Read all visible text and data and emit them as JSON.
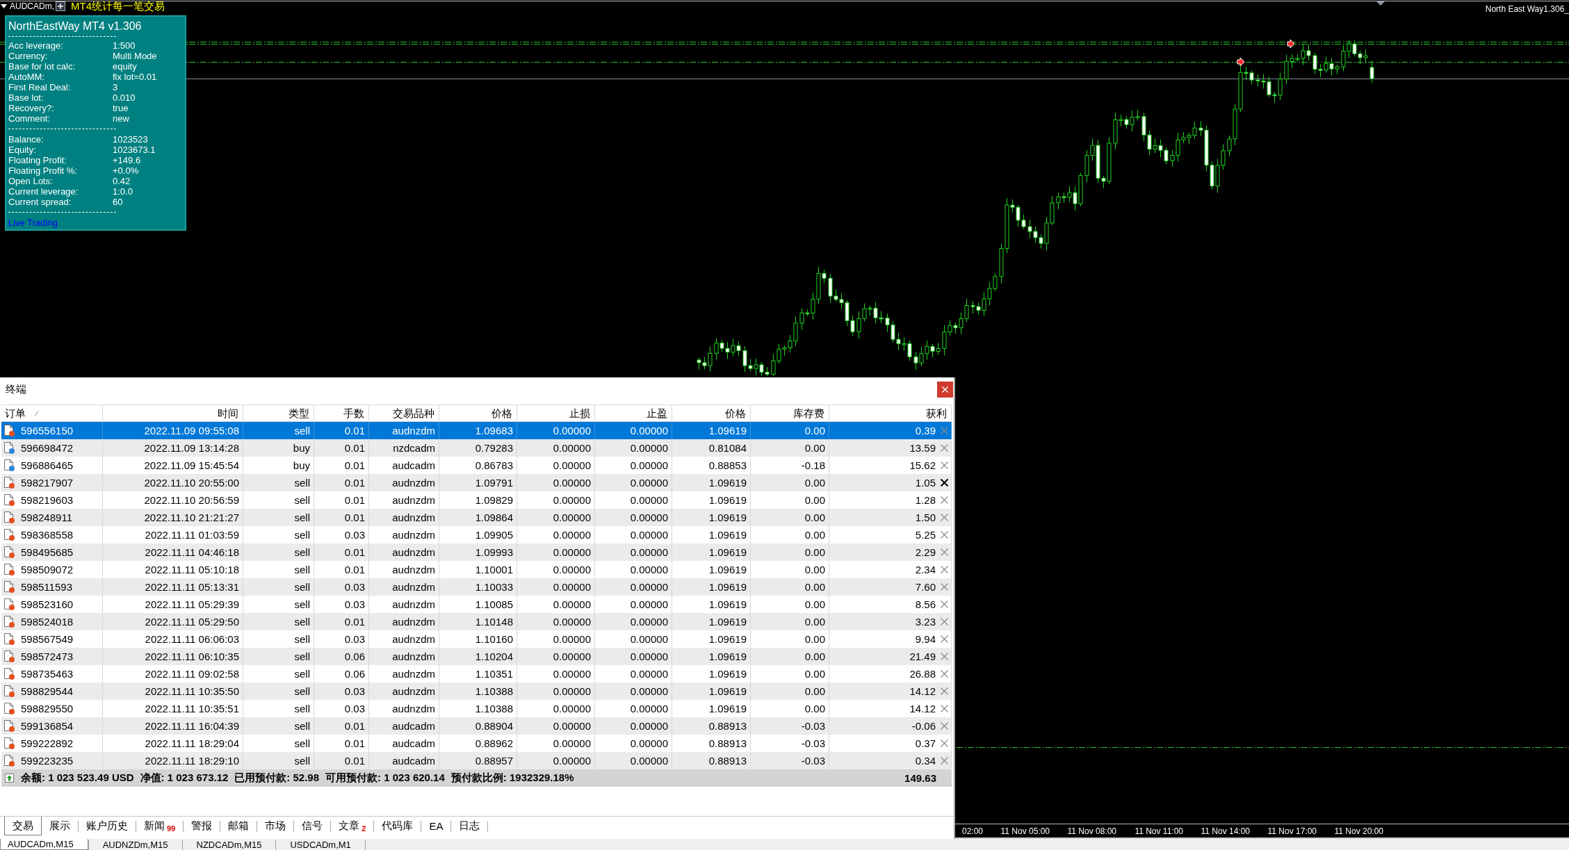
{
  "chart": {
    "symbol_label": "AUDCADm,",
    "indicator_title": "MT4统计每一笔交易",
    "ea_label": "North East Way1.306_",
    "info_panel": {
      "title": "NorthEastWay MT4 v1.306",
      "settings": [
        {
          "label": "Acc leverage:",
          "value": "1:500"
        },
        {
          "label": "Currency:",
          "value": "Multi Mode"
        },
        {
          "label": "Base for lot calc:",
          "value": "equity"
        },
        {
          "label": "AutoMM:",
          "value": "fix lot=0.01"
        },
        {
          "label": "First Real Deal:",
          "value": "3"
        },
        {
          "label": "Base lot:",
          "value": "0.010"
        },
        {
          "label": "Recovery?:",
          "value": "true"
        },
        {
          "label": "Comment:",
          "value": "new"
        }
      ],
      "stats": [
        {
          "label": "Balance:",
          "value": "1023523"
        },
        {
          "label": "Equity:",
          "value": "1023673.1"
        },
        {
          "label": "Floating Profit:",
          "value": "+149.6"
        },
        {
          "label": "Floating Profit %:",
          "value": "+0.0%"
        },
        {
          "label": "Open Lots:",
          "value": "0.42"
        },
        {
          "label": "Current leverage:",
          "value": "1:0.0"
        },
        {
          "label": "Current spread:",
          "value": "60"
        }
      ],
      "mode": "Live Trading"
    },
    "time_axis": [
      "02:00",
      "11 Nov 05:00",
      "11 Nov 08:00",
      "11 Nov 11:00",
      "11 Nov 14:00",
      "11 Nov 17:00",
      "11 Nov 20:00"
    ]
  },
  "terminal": {
    "title": "终端",
    "columns": [
      {
        "label": "订单",
        "sorted": true
      },
      {
        "label": "时间",
        "sorted": false
      },
      {
        "label": "类型",
        "sorted": false
      },
      {
        "label": "手数",
        "sorted": false
      },
      {
        "label": "交易品种",
        "sorted": false
      },
      {
        "label": "价格",
        "sorted": false
      },
      {
        "label": "止损",
        "sorted": false
      },
      {
        "label": "止盈",
        "sorted": false
      },
      {
        "label": "价格",
        "sorted": false
      },
      {
        "label": "库存费",
        "sorted": false
      },
      {
        "label": "获利",
        "sorted": false
      }
    ],
    "rows": [
      {
        "cells": [
          "596556150",
          "2022.11.09 09:55:08",
          "sell",
          "0.01",
          "audnzdm",
          "1.09683",
          "0.00000",
          "0.00000",
          "1.09619",
          "0.00",
          "0.39"
        ],
        "selected": true,
        "color": "#e5501f",
        "close_hover": false
      },
      {
        "cells": [
          "596698472",
          "2022.11.09 13:14:28",
          "buy",
          "0.01",
          "nzdcadm",
          "0.79283",
          "0.00000",
          "0.00000",
          "0.81084",
          "0.00",
          "13.59"
        ],
        "selected": false,
        "color": "#2f86d8",
        "close_hover": false
      },
      {
        "cells": [
          "596886465",
          "2022.11.09 15:45:54",
          "buy",
          "0.01",
          "audcadm",
          "0.86783",
          "0.00000",
          "0.00000",
          "0.88853",
          "-0.18",
          "15.62"
        ],
        "selected": false,
        "color": "#2f86d8",
        "close_hover": false
      },
      {
        "cells": [
          "598217907",
          "2022.11.10 20:55:00",
          "sell",
          "0.01",
          "audnzdm",
          "1.09791",
          "0.00000",
          "0.00000",
          "1.09619",
          "0.00",
          "1.05"
        ],
        "selected": false,
        "color": "#e5501f",
        "close_hover": true
      },
      {
        "cells": [
          "598219603",
          "2022.11.10 20:56:59",
          "sell",
          "0.01",
          "audnzdm",
          "1.09829",
          "0.00000",
          "0.00000",
          "1.09619",
          "0.00",
          "1.28"
        ],
        "selected": false,
        "color": "#e5501f",
        "close_hover": false
      },
      {
        "cells": [
          "598248911",
          "2022.11.10 21:21:27",
          "sell",
          "0.01",
          "audnzdm",
          "1.09864",
          "0.00000",
          "0.00000",
          "1.09619",
          "0.00",
          "1.50"
        ],
        "selected": false,
        "color": "#e5501f",
        "close_hover": false
      },
      {
        "cells": [
          "598368558",
          "2022.11.11 01:03:59",
          "sell",
          "0.03",
          "audnzdm",
          "1.09905",
          "0.00000",
          "0.00000",
          "1.09619",
          "0.00",
          "5.25"
        ],
        "selected": false,
        "color": "#e5501f",
        "close_hover": false
      },
      {
        "cells": [
          "598495685",
          "2022.11.11 04:46:18",
          "sell",
          "0.01",
          "audnzdm",
          "1.09993",
          "0.00000",
          "0.00000",
          "1.09619",
          "0.00",
          "2.29"
        ],
        "selected": false,
        "color": "#e5501f",
        "close_hover": false
      },
      {
        "cells": [
          "598509072",
          "2022.11.11 05:10:18",
          "sell",
          "0.01",
          "audnzdm",
          "1.10001",
          "0.00000",
          "0.00000",
          "1.09619",
          "0.00",
          "2.34"
        ],
        "selected": false,
        "color": "#e5501f",
        "close_hover": false
      },
      {
        "cells": [
          "598511593",
          "2022.11.11 05:13:31",
          "sell",
          "0.03",
          "audnzdm",
          "1.10033",
          "0.00000",
          "0.00000",
          "1.09619",
          "0.00",
          "7.60"
        ],
        "selected": false,
        "color": "#e5501f",
        "close_hover": false
      },
      {
        "cells": [
          "598523160",
          "2022.11.11 05:29:39",
          "sell",
          "0.03",
          "audnzdm",
          "1.10085",
          "0.00000",
          "0.00000",
          "1.09619",
          "0.00",
          "8.56"
        ],
        "selected": false,
        "color": "#e5501f",
        "close_hover": false
      },
      {
        "cells": [
          "598524018",
          "2022.11.11 05:29:50",
          "sell",
          "0.01",
          "audnzdm",
          "1.10148",
          "0.00000",
          "0.00000",
          "1.09619",
          "0.00",
          "3.23"
        ],
        "selected": false,
        "color": "#e5501f",
        "close_hover": false
      },
      {
        "cells": [
          "598567549",
          "2022.11.11 06:06:03",
          "sell",
          "0.03",
          "audnzdm",
          "1.10160",
          "0.00000",
          "0.00000",
          "1.09619",
          "0.00",
          "9.94"
        ],
        "selected": false,
        "color": "#e5501f",
        "close_hover": false
      },
      {
        "cells": [
          "598572473",
          "2022.11.11 06:10:35",
          "sell",
          "0.06",
          "audnzdm",
          "1.10204",
          "0.00000",
          "0.00000",
          "1.09619",
          "0.00",
          "21.49"
        ],
        "selected": false,
        "color": "#e5501f",
        "close_hover": false
      },
      {
        "cells": [
          "598735463",
          "2022.11.11 09:02:58",
          "sell",
          "0.06",
          "audnzdm",
          "1.10351",
          "0.00000",
          "0.00000",
          "1.09619",
          "0.00",
          "26.88"
        ],
        "selected": false,
        "color": "#e5501f",
        "close_hover": false
      },
      {
        "cells": [
          "598829544",
          "2022.11.11 10:35:50",
          "sell",
          "0.03",
          "audnzdm",
          "1.10388",
          "0.00000",
          "0.00000",
          "1.09619",
          "0.00",
          "14.12"
        ],
        "selected": false,
        "color": "#e5501f",
        "close_hover": false
      },
      {
        "cells": [
          "598829550",
          "2022.11.11 10:35:51",
          "sell",
          "0.03",
          "audnzdm",
          "1.10388",
          "0.00000",
          "0.00000",
          "1.09619",
          "0.00",
          "14.12"
        ],
        "selected": false,
        "color": "#e5501f",
        "close_hover": false
      },
      {
        "cells": [
          "599136854",
          "2022.11.11 16:04:39",
          "sell",
          "0.01",
          "audcadm",
          "0.88904",
          "0.00000",
          "0.00000",
          "0.88913",
          "-0.03",
          "-0.06"
        ],
        "selected": false,
        "color": "#e5501f",
        "close_hover": false
      },
      {
        "cells": [
          "599222892",
          "2022.11.11 18:29:04",
          "sell",
          "0.01",
          "audcadm",
          "0.88962",
          "0.00000",
          "0.00000",
          "0.88913",
          "-0.03",
          "0.37"
        ],
        "selected": false,
        "color": "#e5501f",
        "close_hover": false
      },
      {
        "cells": [
          "599223235",
          "2022.11.11 18:29:10",
          "sell",
          "0.01",
          "audcadm",
          "0.88957",
          "0.00000",
          "0.00000",
          "0.88913",
          "-0.03",
          "0.34"
        ],
        "selected": false,
        "color": "#e5501f",
        "close_hover": false
      }
    ],
    "summary": {
      "items": [
        "余额: 1 023 523.49 USD",
        "净值: 1 023 673.12",
        "已用预付款: 52.98",
        "可用预付款: 1 023 620.14",
        "预付款比例: 1932329.18%"
      ],
      "total": "149.63"
    },
    "tabs": [
      {
        "label": "交易",
        "selected": true
      },
      {
        "label": "展示",
        "selected": false
      },
      {
        "label": "账户历史",
        "selected": false
      },
      {
        "label": "新闻",
        "selected": false,
        "count": "99"
      },
      {
        "label": "警报",
        "selected": false
      },
      {
        "label": "邮箱",
        "selected": false
      },
      {
        "label": "市场",
        "selected": false
      },
      {
        "label": "信号",
        "selected": false
      },
      {
        "label": "文章",
        "selected": false,
        "count": "2"
      },
      {
        "label": "代码库",
        "selected": false
      },
      {
        "label": "EA",
        "selected": false
      },
      {
        "label": "日志",
        "selected": false
      }
    ]
  },
  "chart_tabs": [
    {
      "label": "AUDCADm,M15",
      "selected": true
    },
    {
      "label": "AUDNZDm,M15",
      "selected": false
    },
    {
      "label": "NZDCADm,M15",
      "selected": false
    },
    {
      "label": "USDCADm,M1",
      "selected": false
    }
  ]
}
